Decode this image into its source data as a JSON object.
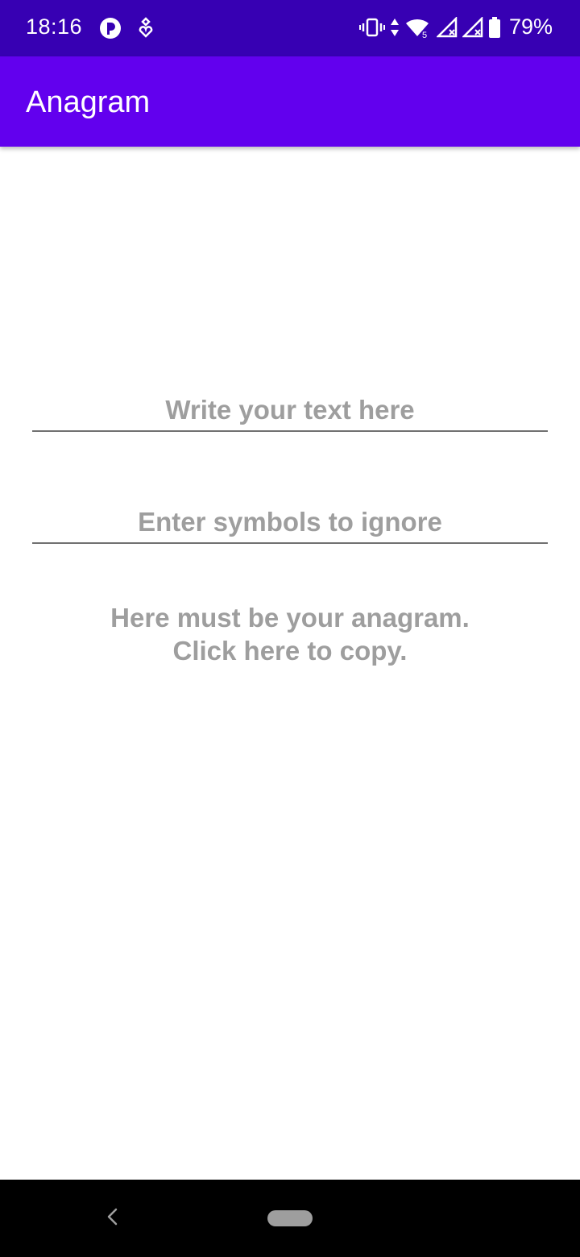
{
  "status_bar": {
    "time": "18:16",
    "battery": "79%",
    "left_icons": [
      "record-icon",
      "location-heart-icon"
    ],
    "right_icons": [
      "vibrate-icon",
      "data-arrows-icon",
      "wifi-icon",
      "signal-icon",
      "signal-icon",
      "battery-icon"
    ],
    "background": "#3700b3"
  },
  "app_bar": {
    "title": "Anagram",
    "background": "#6200ee"
  },
  "form": {
    "text_input": {
      "value": "",
      "placeholder": "Write your text here"
    },
    "ignore_input": {
      "value": "",
      "placeholder": "Enter symbols to ignore"
    }
  },
  "result": {
    "line1": "Here must be your anagram.",
    "line2": "Click here to copy."
  },
  "nav_bar": {
    "icons": [
      "back-icon",
      "home-pill-icon"
    ],
    "background": "#000000"
  }
}
